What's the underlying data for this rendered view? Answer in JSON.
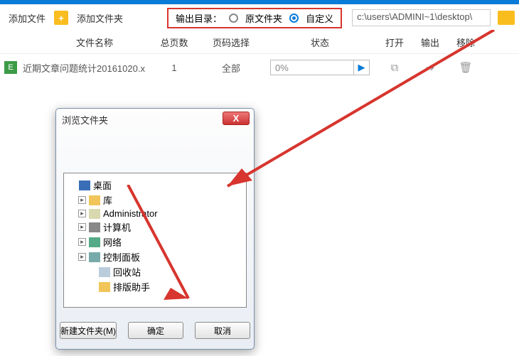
{
  "toolbar": {
    "add_file": "添加文件",
    "add_folder": "添加文件夹",
    "out_label": "输出目录：",
    "opt_original": "原文件夹",
    "opt_custom": "自定义",
    "path": "c:\\users\\ADMINI~1\\desktop\\"
  },
  "columns": {
    "name": "文件名称",
    "pages": "总页数",
    "select": "页码选择",
    "status": "状态",
    "open": "打开",
    "out": "输出",
    "remove": "移除"
  },
  "rows": [
    {
      "icon": "E",
      "name": "近期文章问题统计20161020.x",
      "pages": "1",
      "select": "全部",
      "progress": "0%"
    }
  ],
  "dialog": {
    "title": "浏览文件夹",
    "new_folder": "新建文件夹(M)",
    "ok": "确定",
    "cancel": "取消",
    "tree": [
      {
        "label": "桌面",
        "icon": "i-desk",
        "indent": 0,
        "exp": false
      },
      {
        "label": "库",
        "icon": "i-lib",
        "indent": 1,
        "exp": true
      },
      {
        "label": "Administrator",
        "icon": "i-user",
        "indent": 1,
        "exp": true
      },
      {
        "label": "计算机",
        "icon": "i-comp",
        "indent": 1,
        "exp": true
      },
      {
        "label": "网络",
        "icon": "i-net",
        "indent": 1,
        "exp": true
      },
      {
        "label": "控制面板",
        "icon": "i-cp",
        "indent": 1,
        "exp": true
      },
      {
        "label": "回收站",
        "icon": "i-bin",
        "indent": 2,
        "exp": false
      },
      {
        "label": "排版助手",
        "icon": "i-fold",
        "indent": 2,
        "exp": false
      }
    ]
  }
}
